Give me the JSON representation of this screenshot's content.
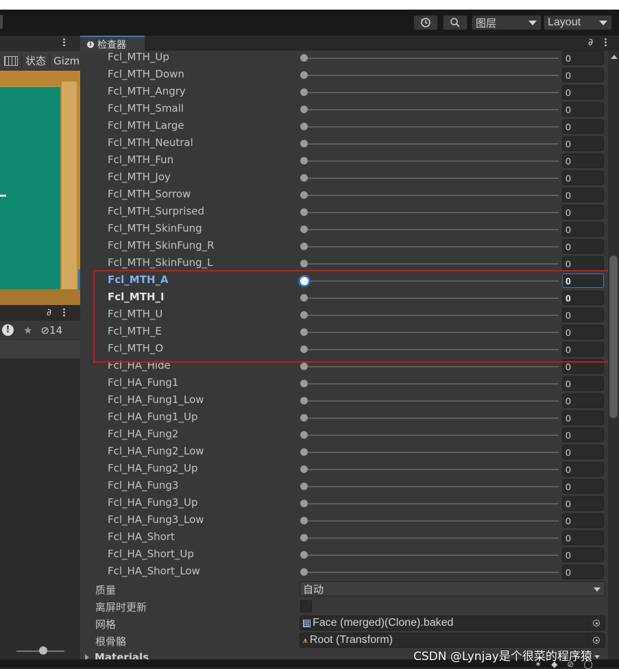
{
  "toolbar": {
    "layers_label": "图层",
    "layout_label": "Layout"
  },
  "left_panel": {
    "stats_label": "状态",
    "gizmos_label": "Gizm",
    "hidden_count": "14"
  },
  "inspector": {
    "tab_label": "检查器",
    "blendshapes": [
      {
        "name": "Fcl_MTH_Up",
        "value": "0",
        "state": "normal"
      },
      {
        "name": "Fcl_MTH_Down",
        "value": "0",
        "state": "normal"
      },
      {
        "name": "Fcl_MTH_Angry",
        "value": "0",
        "state": "normal"
      },
      {
        "name": "Fcl_MTH_Small",
        "value": "0",
        "state": "normal"
      },
      {
        "name": "Fcl_MTH_Large",
        "value": "0",
        "state": "normal"
      },
      {
        "name": "Fcl_MTH_Neutral",
        "value": "0",
        "state": "normal"
      },
      {
        "name": "Fcl_MTH_Fun",
        "value": "0",
        "state": "normal"
      },
      {
        "name": "Fcl_MTH_Joy",
        "value": "0",
        "state": "normal"
      },
      {
        "name": "Fcl_MTH_Sorrow",
        "value": "0",
        "state": "normal"
      },
      {
        "name": "Fcl_MTH_Surprised",
        "value": "0",
        "state": "normal"
      },
      {
        "name": "Fcl_MTH_SkinFung",
        "value": "0",
        "state": "normal"
      },
      {
        "name": "Fcl_MTH_SkinFung_R",
        "value": "0",
        "state": "normal"
      },
      {
        "name": "Fcl_MTH_SkinFung_L",
        "value": "0",
        "state": "normal"
      },
      {
        "name": "Fcl_MTH_A",
        "value": "0",
        "state": "selected"
      },
      {
        "name": "Fcl_MTH_I",
        "value": "0",
        "state": "bold"
      },
      {
        "name": "Fcl_MTH_U",
        "value": "0",
        "state": "normal"
      },
      {
        "name": "Fcl_MTH_E",
        "value": "0",
        "state": "normal"
      },
      {
        "name": "Fcl_MTH_O",
        "value": "0",
        "state": "normal"
      },
      {
        "name": "Fcl_HA_Hide",
        "value": "0",
        "state": "normal"
      },
      {
        "name": "Fcl_HA_Fung1",
        "value": "0",
        "state": "normal"
      },
      {
        "name": "Fcl_HA_Fung1_Low",
        "value": "0",
        "state": "normal"
      },
      {
        "name": "Fcl_HA_Fung1_Up",
        "value": "0",
        "state": "normal"
      },
      {
        "name": "Fcl_HA_Fung2",
        "value": "0",
        "state": "normal"
      },
      {
        "name": "Fcl_HA_Fung2_Low",
        "value": "0",
        "state": "normal"
      },
      {
        "name": "Fcl_HA_Fung2_Up",
        "value": "0",
        "state": "normal"
      },
      {
        "name": "Fcl_HA_Fung3",
        "value": "0",
        "state": "normal"
      },
      {
        "name": "Fcl_HA_Fung3_Up",
        "value": "0",
        "state": "normal"
      },
      {
        "name": "Fcl_HA_Fung3_Low",
        "value": "0",
        "state": "normal"
      },
      {
        "name": "Fcl_HA_Short",
        "value": "0",
        "state": "normal"
      },
      {
        "name": "Fcl_HA_Short_Up",
        "value": "0",
        "state": "normal"
      },
      {
        "name": "Fcl_HA_Short_Low",
        "value": "0",
        "state": "normal"
      }
    ],
    "quality": {
      "label": "质量",
      "value": "自动"
    },
    "update_offscreen": {
      "label": "离屏时更新",
      "checked": false
    },
    "mesh": {
      "label": "网格",
      "value": "Face (merged)(Clone).baked"
    },
    "root_bone": {
      "label": "根骨骼",
      "value": "Root (Transform)"
    },
    "materials_label": "Materials"
  },
  "watermark": "CSDN @Lynjay是个很菜的程序猿",
  "colors": {
    "accent": "#3a79bb",
    "selected_label": "#7cb1f0",
    "highlight_box": "#c8191f"
  }
}
